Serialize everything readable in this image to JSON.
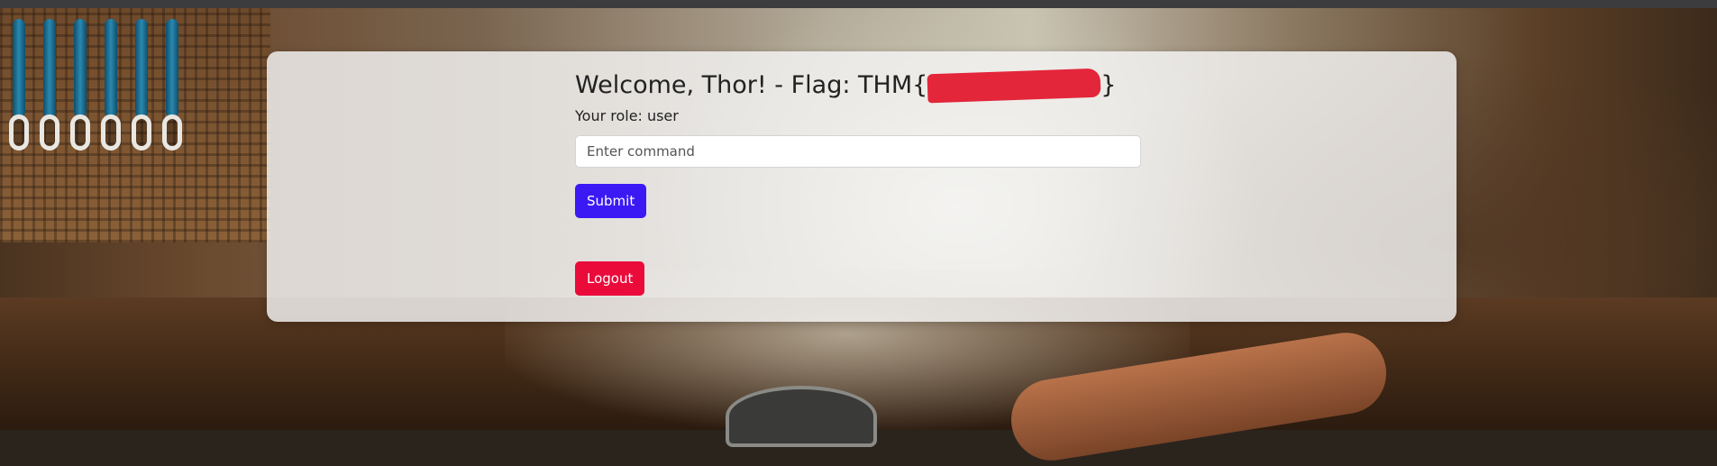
{
  "page": {
    "welcome_text": "Welcome, Thor! - Flag: THM{",
    "flag_close": "}",
    "role_label": "Your role:",
    "role_value": "user"
  },
  "form": {
    "command_placeholder": "Enter command",
    "command_value": "",
    "submit_label": "Submit"
  },
  "actions": {
    "logout_label": "Logout"
  },
  "colors": {
    "submit": "#3a19f5",
    "logout": "#ea0b3b",
    "redaction": "#e3263a"
  }
}
